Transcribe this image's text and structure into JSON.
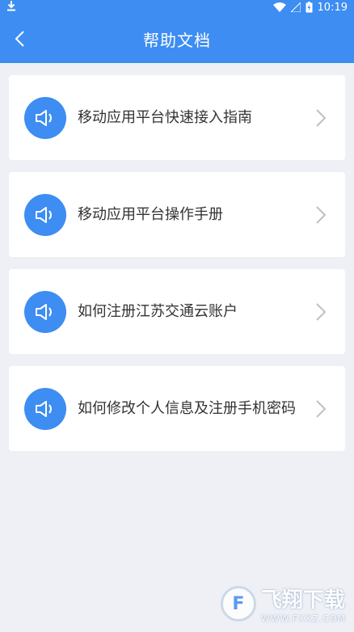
{
  "status_bar": {
    "time": "10:19",
    "icons": [
      "download-icon",
      "wifi-icon",
      "signal-icon",
      "battery-icon"
    ]
  },
  "header": {
    "title": "帮助文档",
    "back_icon": "chevron-left-icon"
  },
  "help_items": [
    {
      "label": "移动应用平台快速接入指南",
      "icon": "speaker-icon"
    },
    {
      "label": "移动应用平台操作手册",
      "icon": "speaker-icon"
    },
    {
      "label": "如何注册江苏交通云账户",
      "icon": "speaker-icon"
    },
    {
      "label": "如何修改个人信息及注册手机密码",
      "icon": "speaker-icon"
    }
  ],
  "watermark": {
    "cn": "飞翔下载",
    "en": "WWW.FXXZ.COM"
  },
  "colors": {
    "primary": "#3d8df2",
    "background": "#eef0f5",
    "card": "#ffffff",
    "text": "#333333",
    "chevron": "#c0c0c0"
  }
}
